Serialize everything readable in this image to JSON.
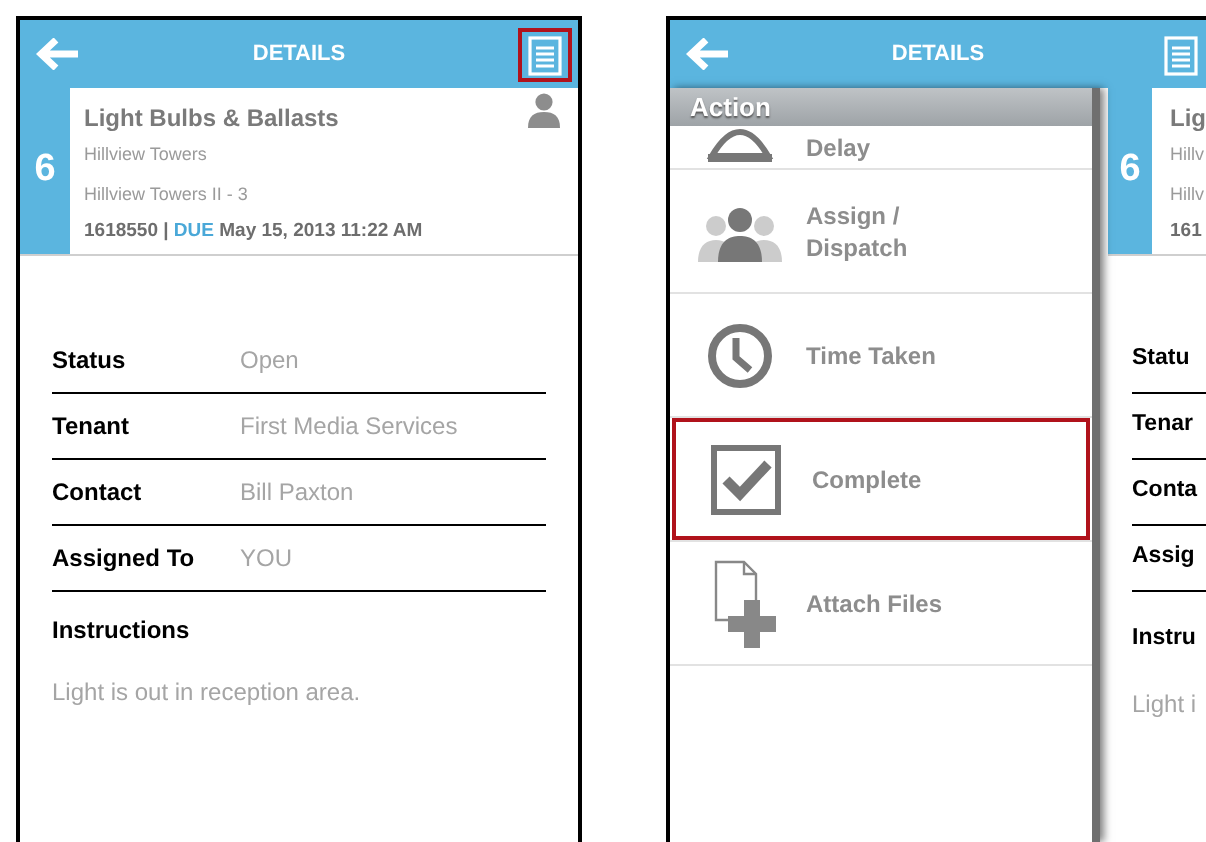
{
  "left_screen": {
    "title": "DETAILS",
    "menu_highlighted": true,
    "card": {
      "number": "6",
      "title": "Light Bulbs & Ballasts",
      "building": "Hillview Towers",
      "unit": "Hillview Towers II - 3",
      "id": "1618550 |",
      "due_label": "DUE",
      "due": "May 15, 2013 11:22 AM"
    },
    "fields": [
      {
        "label": "Status",
        "value": "Open"
      },
      {
        "label": "Tenant",
        "value": "First Media Services"
      },
      {
        "label": "Contact",
        "value": "Bill Paxton"
      },
      {
        "label": "Assigned To",
        "value": "YOU"
      }
    ],
    "instructions_label": "Instructions",
    "instructions": "Light is out in reception area."
  },
  "right_screen": {
    "title": "DETAILS",
    "drawer": {
      "header": "Action",
      "actions": [
        {
          "kind": "delay",
          "label": "Delay",
          "highlighted": false
        },
        {
          "kind": "assign",
          "label": "Assign / Dispatch",
          "highlighted": false
        },
        {
          "kind": "time",
          "label": "Time Taken",
          "highlighted": false
        },
        {
          "kind": "complete",
          "label": "Complete",
          "highlighted": true
        },
        {
          "kind": "attach",
          "label": "Attach Files",
          "highlighted": false
        }
      ]
    },
    "behind": {
      "number": "6",
      "lines": [
        "Lig",
        "Hillv",
        "Hillv",
        "161"
      ],
      "labels": [
        "Statu",
        "Tenar",
        "Conta",
        "Assig",
        "Instru"
      ],
      "text": "Light i"
    }
  }
}
